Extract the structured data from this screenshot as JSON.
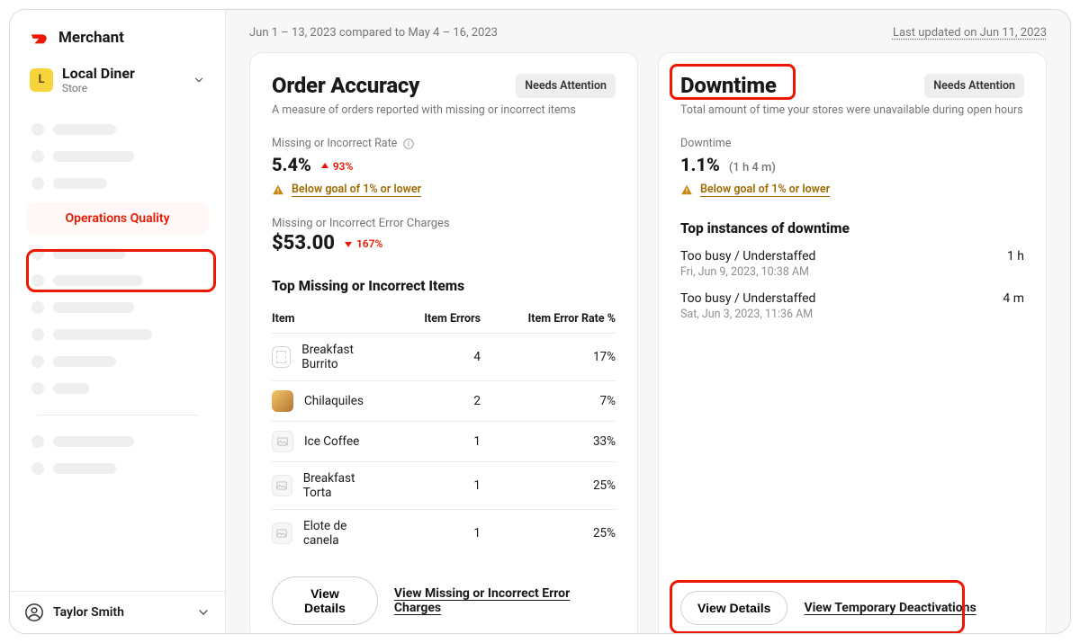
{
  "brand": "Merchant",
  "store": {
    "initial": "L",
    "name": "Local Diner",
    "subtitle": "Store"
  },
  "nav": {
    "selected_label": "Operations Quality"
  },
  "user": {
    "name": "Taylor Smith"
  },
  "topbar": {
    "date_range": "Jun 1 – 13, 2023 compared to May 4 – 16, 2023",
    "last_updated": "Last updated on Jun 11, 2023"
  },
  "accuracy": {
    "title": "Order Accuracy",
    "chip": "Needs Attention",
    "subtitle": "A measure of orders reported with missing or incorrect items",
    "rate_label": "Missing or Incorrect Rate",
    "rate_value": "5.4%",
    "rate_delta": "93%",
    "goal_text": "Below goal of 1% or lower",
    "charges_label": "Missing or Incorrect Error Charges",
    "charges_value": "$53.00",
    "charges_delta": "167%",
    "items_heading": "Top Missing or Incorrect Items",
    "table": {
      "cols": [
        "Item",
        "Item Errors",
        "Item Error Rate %"
      ],
      "rows": [
        {
          "name": "Breakfast Burrito",
          "errors": "4",
          "rate": "17%",
          "thumb": "broken"
        },
        {
          "name": "Chilaquiles",
          "errors": "2",
          "rate": "7%",
          "thumb": "img"
        },
        {
          "name": "Ice Coffee",
          "errors": "1",
          "rate": "33%",
          "thumb": "placeholder"
        },
        {
          "name": "Breakfast Torta",
          "errors": "1",
          "rate": "25%",
          "thumb": "placeholder"
        },
        {
          "name": "Elote de canela",
          "errors": "1",
          "rate": "25%",
          "thumb": "placeholder"
        }
      ]
    },
    "view_details": "View Details",
    "link": "View Missing or Incorrect Error Charges"
  },
  "downtime": {
    "title": "Downtime",
    "chip": "Needs Attention",
    "subtitle": "Total amount of time your stores were unavailable during open hours",
    "label": "Downtime",
    "value": "1.1%",
    "value_paren": "(1 h 4 m)",
    "goal_text": "Below goal of 1% or lower",
    "instances_heading": "Top instances of downtime",
    "instances": [
      {
        "reason": "Too busy / Understaffed",
        "when": "Fri, Jun 9, 2023, 10:38 AM",
        "duration": "1 h"
      },
      {
        "reason": "Too busy / Understaffed",
        "when": "Sat, Jun 3, 2023, 11:36 AM",
        "duration": "4 m"
      }
    ],
    "view_details": "View Details",
    "link": "View Temporary Deactivations"
  }
}
